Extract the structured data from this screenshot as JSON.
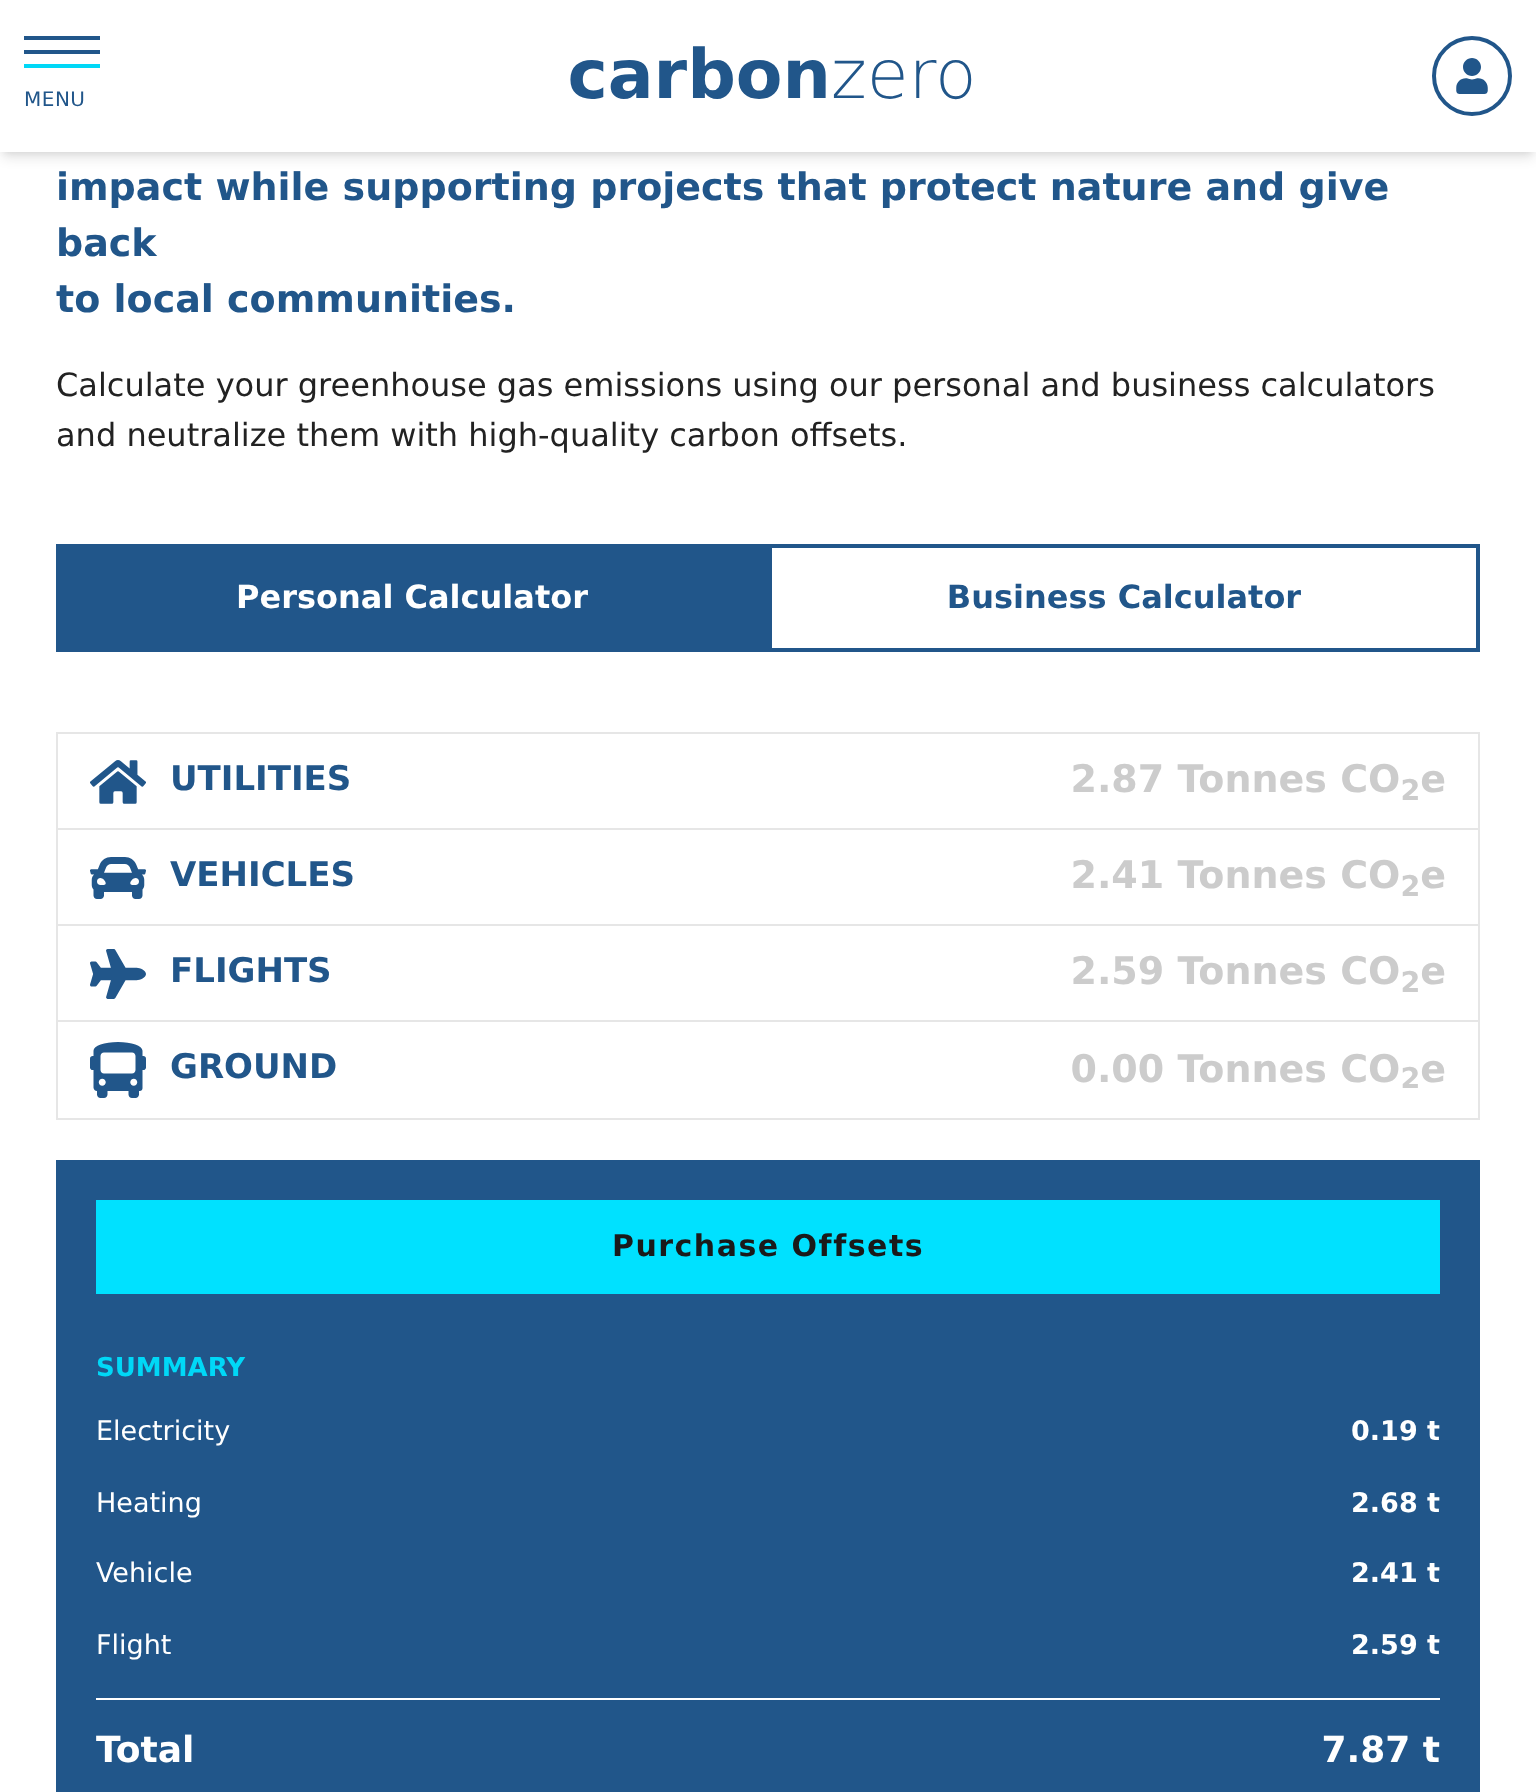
{
  "header": {
    "menu_label": "MENU",
    "logo": {
      "bold": "carbon",
      "light": "zero"
    }
  },
  "intro": {
    "lead": [
      "impact while supporting projects that protect nature and give back",
      "to local communities."
    ],
    "body": "Calculate your greenhouse gas emissions using our personal and business calculators and neutralize them with high-quality carbon offsets."
  },
  "tabs": [
    {
      "label": "Personal Calculator",
      "selected": true
    },
    {
      "label": "Business Calculator",
      "selected": false
    }
  ],
  "categories": [
    {
      "kind": "house",
      "label": "UTILITIES",
      "value": "2.87 Tonnes CO$_{2}$e"
    },
    {
      "kind": "car",
      "label": "VEHICLES",
      "value": "2.41 Tonnes CO$_{2}$e"
    },
    {
      "kind": "plane",
      "label": "FLIGHTS",
      "value": "2.59 Tonnes CO$_{2}$e"
    },
    {
      "kind": "bus",
      "label": "GROUND",
      "value": "0.00 Tonnes CO$_{2}$e"
    }
  ],
  "summary": {
    "button": "Purchase Offsets",
    "heading": "SUMMARY",
    "rows": [
      {
        "label": "Electricity",
        "value": "0.19 t"
      },
      {
        "label": "Heating",
        "value": "2.68 t"
      },
      {
        "label": "Vehicle",
        "value": "2.41 t"
      },
      {
        "label": "Flight",
        "value": "2.59 t"
      }
    ],
    "total": {
      "label": "Total",
      "value": "7.87 t"
    }
  }
}
